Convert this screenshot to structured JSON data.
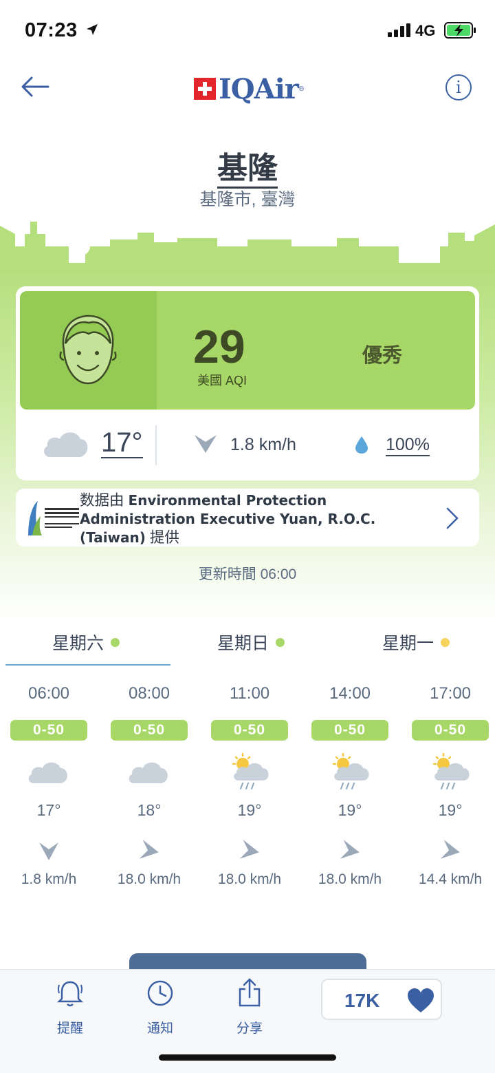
{
  "status": {
    "time": "07:23",
    "network": "4G"
  },
  "header": {
    "brand": "IQAir",
    "info_glyph": "i"
  },
  "location": {
    "city": "基隆",
    "region": "基隆市, 臺灣"
  },
  "aqi": {
    "value": "29",
    "label": "美國 AQI",
    "status": "優秀",
    "color": "#a7d867"
  },
  "current_weather": {
    "temperature": "17°",
    "wind": "1.8 km/h",
    "humidity": "100%"
  },
  "source": {
    "prefix": "数据由 ",
    "name": "Environmental Protection Administration Executive Yuan, R.O.C. (Taiwan)",
    "suffix": " 提供"
  },
  "updated": "更新時間 06:00",
  "days": [
    {
      "label": "星期六",
      "dot_color": "#a7d867"
    },
    {
      "label": "星期日",
      "dot_color": "#a7d867"
    },
    {
      "label": "星期一",
      "dot_color": "#f6d35a"
    }
  ],
  "hours": [
    {
      "time": "06:00",
      "aqi": "0-50",
      "icon": "cloud-icon",
      "temp": "17°",
      "wind_icon": "wind-south-icon",
      "wind": "1.8 km/h"
    },
    {
      "time": "08:00",
      "aqi": "0-50",
      "icon": "cloud-icon",
      "temp": "18°",
      "wind_icon": "wind-east-icon",
      "wind": "18.0 km/h"
    },
    {
      "time": "11:00",
      "aqi": "0-50",
      "icon": "sun-cloud-rain-icon",
      "temp": "19°",
      "wind_icon": "wind-east-icon",
      "wind": "18.0 km/h"
    },
    {
      "time": "14:00",
      "aqi": "0-50",
      "icon": "sun-cloud-rain-icon",
      "temp": "19°",
      "wind_icon": "wind-east-icon",
      "wind": "18.0 km/h"
    },
    {
      "time": "17:00",
      "aqi": "0-50",
      "icon": "sun-cloud-rain-icon",
      "temp": "19°",
      "wind_icon": "wind-east-icon",
      "wind": "14.4 km/h"
    }
  ],
  "tabbar": {
    "remind": "提醒",
    "notify": "通知",
    "share": "分享",
    "likes": "17K"
  }
}
